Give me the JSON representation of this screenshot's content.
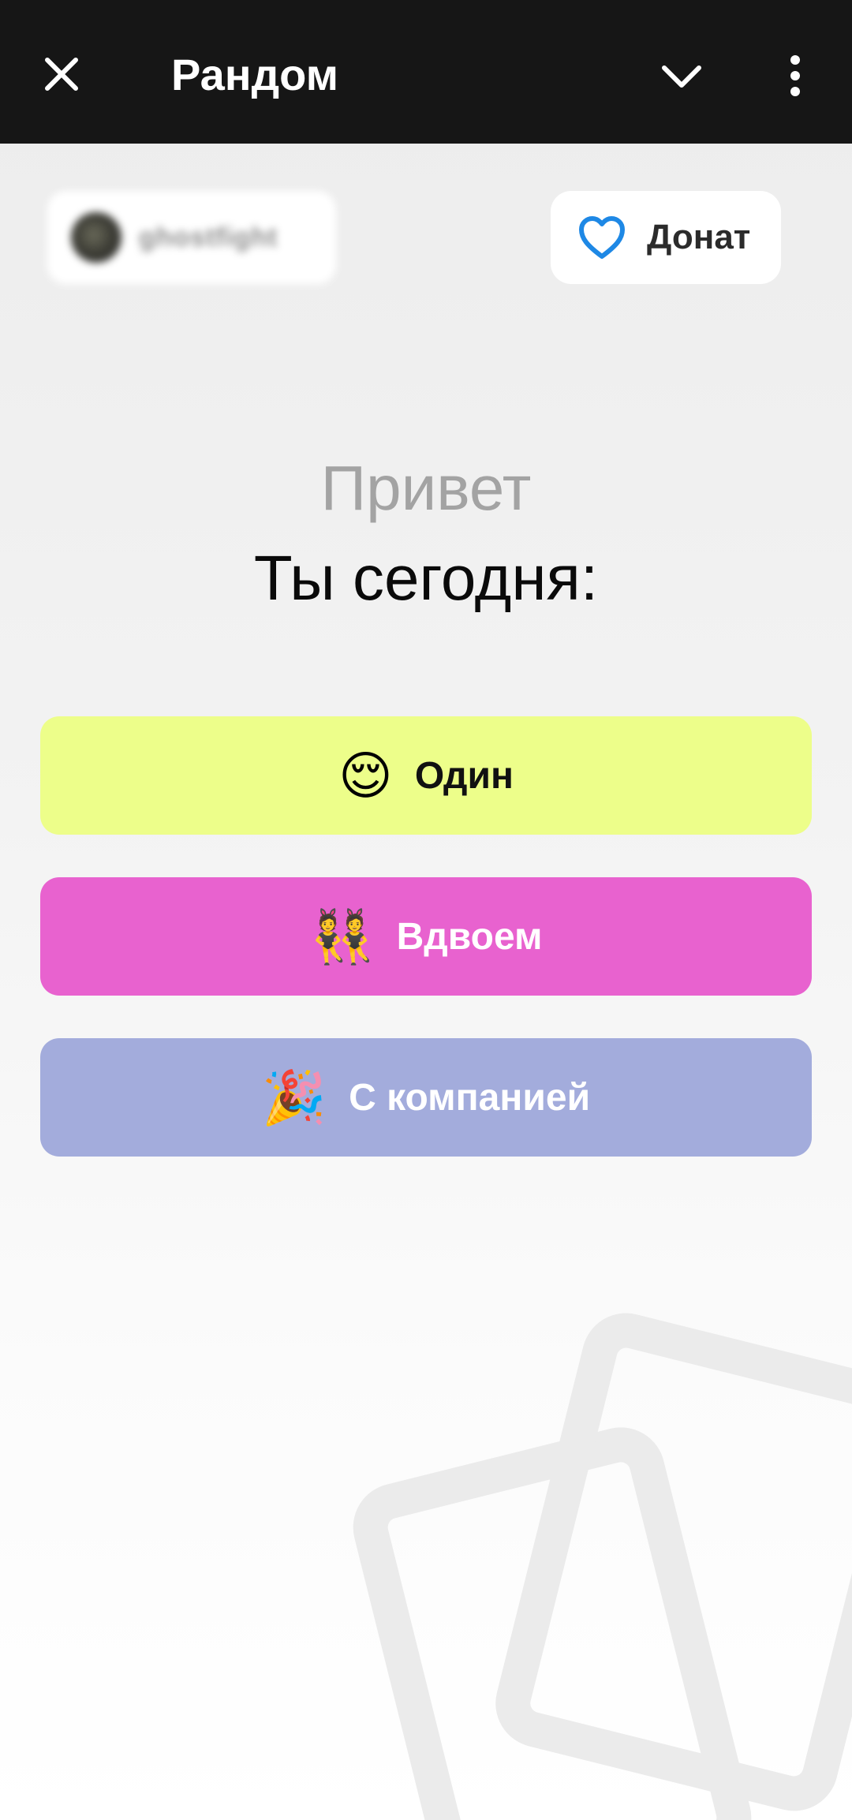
{
  "appbar": {
    "title": "Рандом",
    "icons": {
      "close": "close-icon",
      "collapse": "chevron-down-icon",
      "menu": "more-vert-icon"
    }
  },
  "user": {
    "name": "ghostfight",
    "avatar_icon": "avatar"
  },
  "donate": {
    "label": "Донат",
    "icon": "heart-icon",
    "icon_color": "#1e88e5"
  },
  "greeting": {
    "hello": "Привет",
    "question": "Ты сегодня:"
  },
  "modes": [
    {
      "emoji": "😌",
      "label": "Один",
      "color": "#edfe8a"
    },
    {
      "emoji": "👯",
      "label": "Вдвоем",
      "color": "#e862cf"
    },
    {
      "emoji": "🎉",
      "label": "С компанией",
      "color": "#a3acdc"
    }
  ]
}
